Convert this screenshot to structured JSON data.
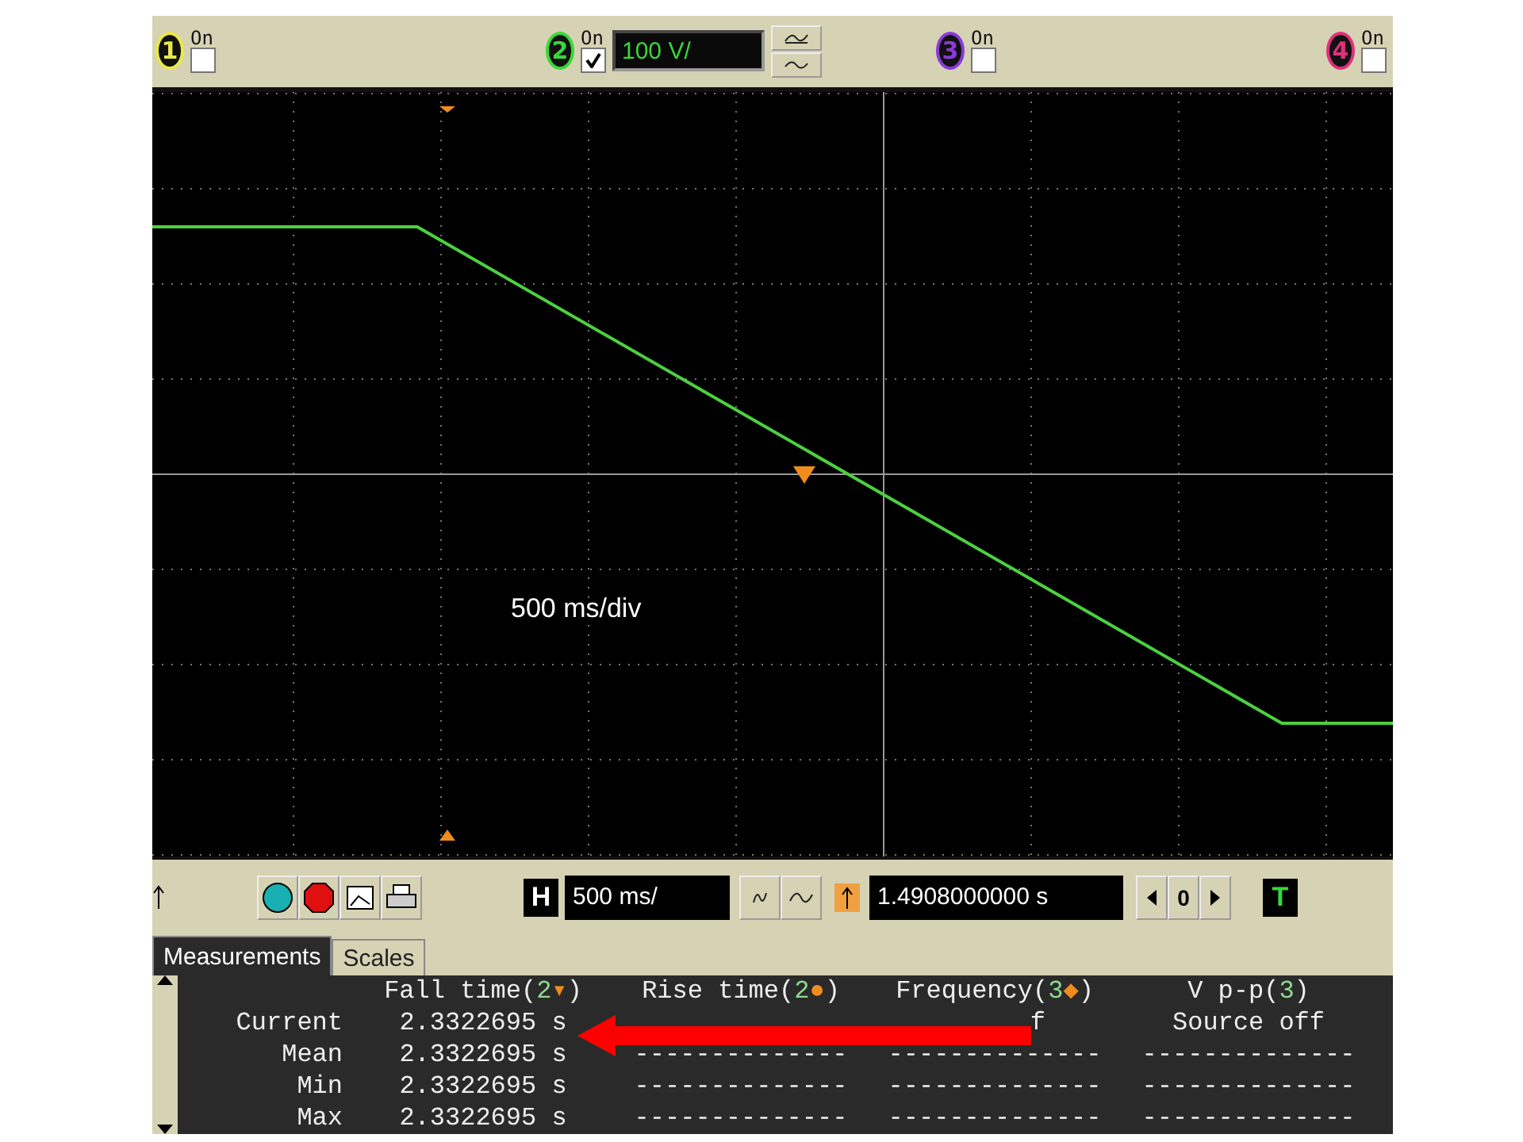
{
  "channels": [
    {
      "number": "1",
      "color": "#e8e84a",
      "label": "On",
      "checked": false
    },
    {
      "number": "2",
      "color": "#38d838",
      "label": "On",
      "checked": true,
      "scale": "100 V/"
    },
    {
      "number": "3",
      "color": "#8a3ad8",
      "label": "On",
      "checked": false
    },
    {
      "number": "4",
      "color": "#e0307a",
      "label": "On",
      "checked": false
    }
  ],
  "annotation": "500 ms/div",
  "toolbar": {
    "timebase": "500 ms/",
    "h_label": "H",
    "position": "1.4908000000 s",
    "step": "0",
    "t_label": "T"
  },
  "tabs": [
    {
      "label": "Measurements",
      "selected": true
    },
    {
      "label": "Scales",
      "selected": false
    }
  ],
  "measurements": {
    "columns": [
      {
        "before": "Fall time(",
        "channel": "2",
        "marker": "▾",
        "after": ")"
      },
      {
        "before": "Rise time(",
        "channel": "2",
        "marker": "●",
        "after": ")"
      },
      {
        "before": "Frequency(",
        "channel": "3",
        "marker": "◆",
        "after": ")"
      },
      {
        "before": "V p-p(",
        "channel": "3",
        "after": ")"
      }
    ],
    "rows": [
      {
        "label": "Current",
        "cells": [
          "2.3322695 s",
          "",
          "f",
          "Source off"
        ]
      },
      {
        "label": "Mean",
        "cells": [
          "2.3322695 s",
          "--------------",
          "--------------",
          "--------------"
        ]
      },
      {
        "label": "Min",
        "cells": [
          "2.3322695 s",
          "--------------",
          "--------------",
          "--------------"
        ]
      },
      {
        "label": "Max",
        "cells": [
          "2.3322695 s",
          "--------------",
          "--------------",
          "--------------"
        ]
      }
    ]
  }
}
